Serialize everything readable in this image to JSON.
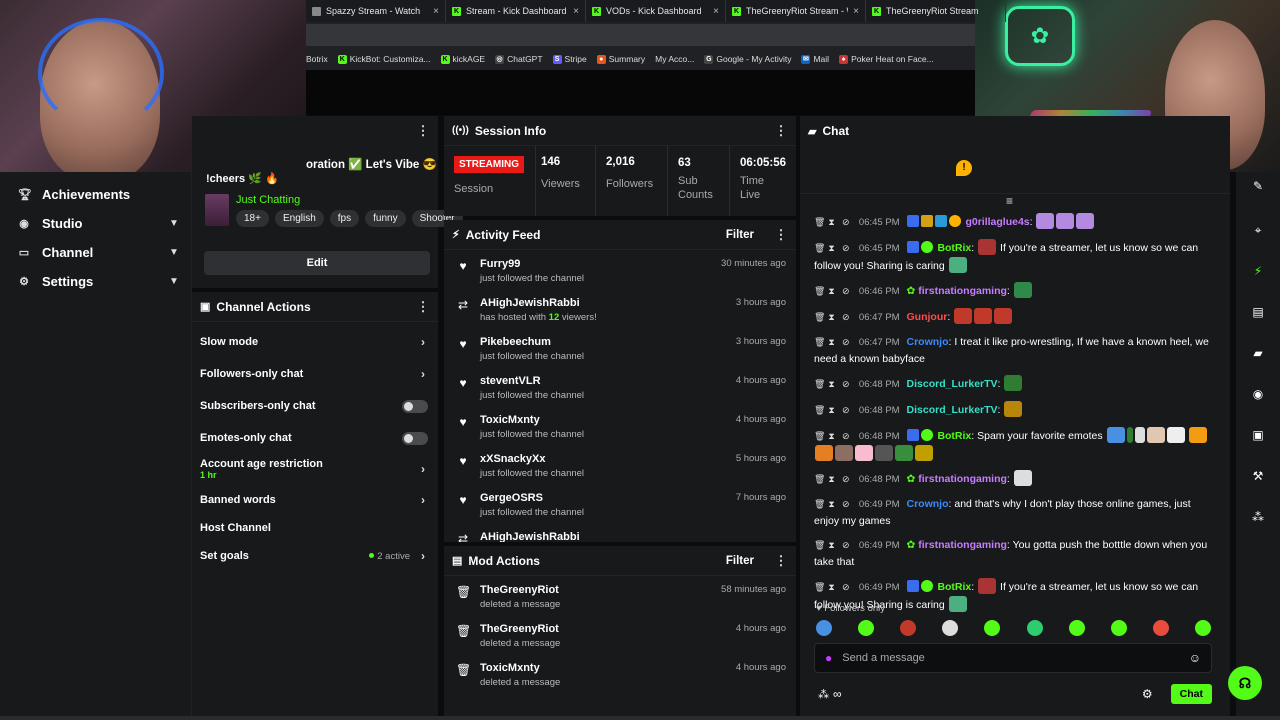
{
  "browser": {
    "tabs": [
      {
        "title": "Spazzy Stream - Watch"
      },
      {
        "title": "Stream - Kick Dashboard"
      },
      {
        "title": "VODs - Kick Dashboard"
      },
      {
        "title": "TheGreenyRiot Stream - Wa"
      },
      {
        "title": "TheGreenyRiot Stream"
      }
    ],
    "bookmarks": [
      "Botrix",
      "KickBot: Customiza...",
      "kickAGE",
      "ChatGPT",
      "Stripe",
      "Summary",
      "My Acco...",
      "Google - My Activity",
      "Mail",
      "Poker Heat on Face..."
    ]
  },
  "nav": {
    "items": [
      {
        "label": "Achievements",
        "icon": "trophy-icon",
        "has_chevron": false
      },
      {
        "label": "Studio",
        "icon": "studio-icon",
        "has_chevron": true
      },
      {
        "label": "Channel",
        "icon": "channel-icon",
        "has_chevron": true
      },
      {
        "label": "Settings",
        "icon": "gear-icon",
        "has_chevron": true
      }
    ]
  },
  "stream_info": {
    "title_partial": "oration ✅ Let's Vibe 😎",
    "cheers": "!cheers 🌿 🔥",
    "category": "Just Chatting",
    "tags": [
      "18+",
      "English",
      "fps",
      "funny",
      "Shooter"
    ],
    "edit_label": "Edit"
  },
  "channel_actions": {
    "title": "Channel Actions",
    "rows": {
      "slow_mode": "Slow mode",
      "followers_only": "Followers-only chat",
      "subscribers_only": "Subscribers-only chat",
      "emotes_only": "Emotes-only chat",
      "account_age": "Account age restriction",
      "account_age_value": "1 hr",
      "banned_words": "Banned words",
      "host_channel": "Host Channel",
      "set_goals": "Set goals",
      "goals_active": "2 active"
    }
  },
  "session": {
    "title": "Session Info",
    "status": "STREAMING",
    "status_label": "Session",
    "viewers": "146",
    "viewers_label": "Viewers",
    "followers": "2,016",
    "followers_label": "Followers",
    "subs": "63",
    "subs_label_1": "Sub",
    "subs_label_2": "Counts",
    "time": "06:05:56",
    "time_label_1": "Time",
    "time_label_2": "Live"
  },
  "activity": {
    "title": "Activity Feed",
    "filter": "Filter",
    "items": [
      {
        "name": "Furry99",
        "desc": "just followed the channel",
        "time": "30 minutes ago",
        "icon": "heart-icon"
      },
      {
        "name": "AHighJewishRabbi",
        "desc_pre": "has hosted with ",
        "desc_num": "12",
        "desc_post": " viewers!",
        "time": "3 hours ago",
        "icon": "host-icon"
      },
      {
        "name": "Pikebeechum",
        "desc": "just followed the channel",
        "time": "3 hours ago",
        "icon": "heart-icon"
      },
      {
        "name": "steventVLR",
        "desc": "just followed the channel",
        "time": "4 hours ago",
        "icon": "heart-icon"
      },
      {
        "name": "ToxicMxnty",
        "desc": "just followed the channel",
        "time": "4 hours ago",
        "icon": "heart-icon"
      },
      {
        "name": "xXSnackyXx",
        "desc": "just followed the channel",
        "time": "5 hours ago",
        "icon": "heart-icon"
      },
      {
        "name": "GergeOSRS",
        "desc": "just followed the channel",
        "time": "7 hours ago",
        "icon": "heart-icon"
      },
      {
        "name": "AHighJewishRabbi",
        "desc": "",
        "time": "",
        "icon": "host-icon"
      }
    ]
  },
  "mod_actions": {
    "title": "Mod Actions",
    "filter": "Filter",
    "items": [
      {
        "name": "TheGreenyRiot",
        "desc": "deleted a message",
        "time": "58 minutes ago"
      },
      {
        "name": "TheGreenyRiot",
        "desc": "deleted a message",
        "time": "4 hours ago"
      },
      {
        "name": "ToxicMxnty",
        "desc": "deleted a message",
        "time": "4 hours ago"
      }
    ]
  },
  "chat": {
    "title": "Chat",
    "messages": [
      {
        "time": "06:45 PM",
        "user": "g0rillaglue4s",
        "color": "#c77dff",
        "text": ""
      },
      {
        "time": "06:45 PM",
        "user": "BotRix",
        "color": "#53fc18",
        "text": "If you're a streamer, let us know so we can follow you! Sharing is caring"
      },
      {
        "time": "06:46 PM",
        "user": "firstnationgaming",
        "color": "#c77dff",
        "text": ""
      },
      {
        "time": "06:47 PM",
        "user": "Gunjour",
        "color": "#ff4d4d",
        "text": ""
      },
      {
        "time": "06:47 PM",
        "user": "Crownjo",
        "color": "#3a8bff",
        "text": "I treat it like pro-wrestling, If we have a known heel, we need a known babyface"
      },
      {
        "time": "06:48 PM",
        "user": "Discord_LurkerTV",
        "color": "#35e0c9",
        "text": ""
      },
      {
        "time": "06:48 PM",
        "user": "Discord_LurkerTV",
        "color": "#35e0c9",
        "text": ""
      },
      {
        "time": "06:48 PM",
        "user": "BotRix",
        "color": "#53fc18",
        "text": "Spam your favorite emotes"
      },
      {
        "time": "06:48 PM",
        "user": "firstnationgaming",
        "color": "#c77dff",
        "text": ""
      },
      {
        "time": "06:49 PM",
        "user": "Crownjo",
        "color": "#3a8bff",
        "text": "and that's why I don't play those online games, just enjoy my games"
      },
      {
        "time": "06:49 PM",
        "user": "firstnationgaming",
        "color": "#c77dff",
        "text": "You gotta push the botttle down when you take that"
      },
      {
        "time": "06:49 PM",
        "user": "BotRix",
        "color": "#53fc18",
        "text": "If you're a streamer, let us know so we can follow you! Sharing is caring"
      }
    ],
    "followers_only": "Followers only",
    "placeholder": "Send a message",
    "send_label": "Chat"
  },
  "colors": {
    "accent": "#53fc18",
    "live": "#e91916",
    "panel": "#18191b"
  }
}
